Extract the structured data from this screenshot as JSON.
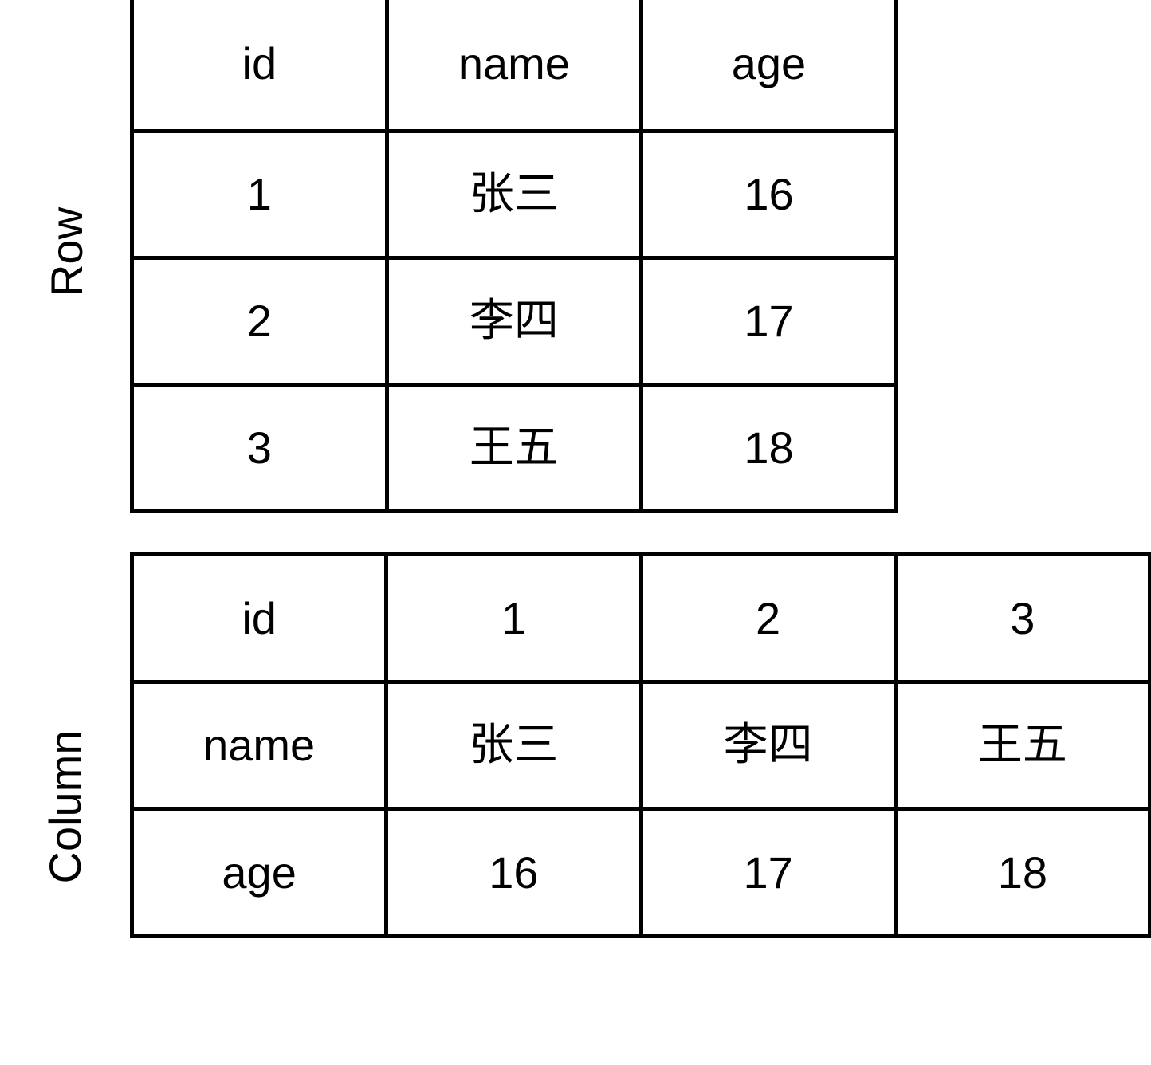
{
  "labels": {
    "row": "Row",
    "column": "Column"
  },
  "row_table": {
    "orientation": "row-oriented",
    "header": [
      "id",
      "name",
      "age"
    ],
    "rows": [
      [
        "1",
        "张三",
        "16"
      ],
      [
        "2",
        "李四",
        "17"
      ],
      [
        "3",
        "王五",
        "18"
      ]
    ]
  },
  "column_table": {
    "orientation": "column-oriented",
    "rows": [
      [
        "id",
        "1",
        "2",
        "3"
      ],
      [
        "name",
        "张三",
        "李四",
        "王五"
      ],
      [
        "age",
        "16",
        "17",
        "18"
      ]
    ]
  },
  "chart_data": {
    "type": "table",
    "title": "",
    "tables": [
      {
        "name": "Row",
        "columns": [
          "id",
          "name",
          "age"
        ],
        "records": [
          {
            "id": "1",
            "name": "张三",
            "age": "16"
          },
          {
            "id": "2",
            "name": "李四",
            "age": "17"
          },
          {
            "id": "3",
            "name": "王五",
            "age": "18"
          }
        ]
      },
      {
        "name": "Column",
        "field_names": [
          "id",
          "name",
          "age"
        ],
        "values": [
          [
            "1",
            "2",
            "3"
          ],
          [
            "张三",
            "李四",
            "王五"
          ],
          [
            "16",
            "17",
            "18"
          ]
        ]
      }
    ]
  },
  "colors": {
    "background": "#ffffff",
    "border": "#000000",
    "text": "#000000"
  }
}
